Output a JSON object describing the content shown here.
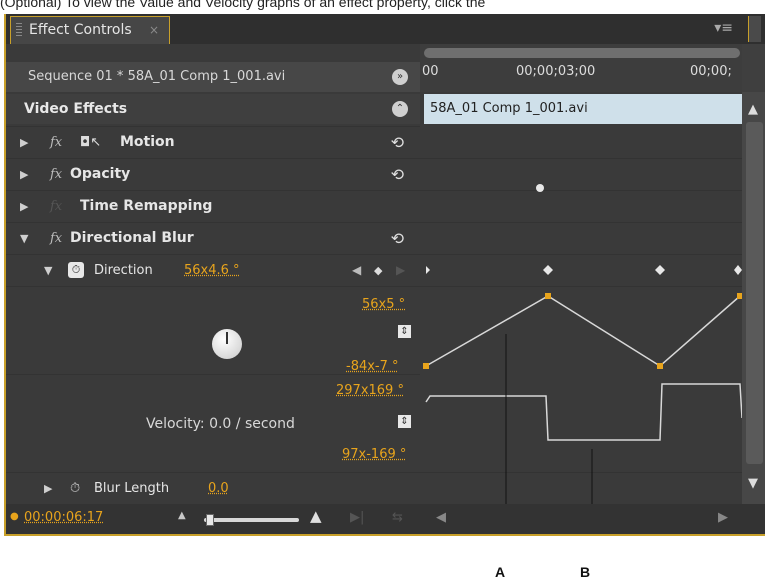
{
  "caption": "(Optional) To view the Value and Velocity graphs of an effect property, click the",
  "panel": {
    "tab_label": "Effect Controls",
    "tab_close": "×",
    "menu_icon": "panel-menu-icon"
  },
  "sequence": {
    "label": "Sequence 01 * 58A_01 Comp 1_001.avi"
  },
  "video_effects": {
    "heading": "Video Effects"
  },
  "effects": [
    {
      "label": "Motion",
      "fx": "fx",
      "reset": "⟲"
    },
    {
      "label": "Opacity",
      "fx": "fx",
      "reset": "⟲"
    },
    {
      "label": "Time Remapping",
      "fx": "fx"
    },
    {
      "label": "Directional Blur",
      "fx": "fx",
      "reset": "⟲"
    }
  ],
  "direction": {
    "label": "Direction",
    "value": "56x4.6 °",
    "graph_max": "56x5 °",
    "graph_min": "-84x-7 °",
    "velocity_max": "297x169 °",
    "velocity_min": "97x-169 °",
    "velocity_label": "Velocity: 0.0 / second"
  },
  "blur_length": {
    "label": "Blur Length",
    "value": "0.0"
  },
  "footer": {
    "timecode": "00:00:06:17"
  },
  "timeline": {
    "ruler_label_1": "00;00;03;00",
    "ruler_label_2": "00;00;",
    "ruler_label_0": "00",
    "clip_label": "58A_01 Comp 1_001.avi"
  },
  "callouts": {
    "a": "A",
    "b": "B"
  },
  "colors": {
    "accent": "#e8a41c",
    "panel_bg": "#3a3a3a",
    "clip_bg": "#cfe0ea",
    "border": "#c8a02a"
  }
}
